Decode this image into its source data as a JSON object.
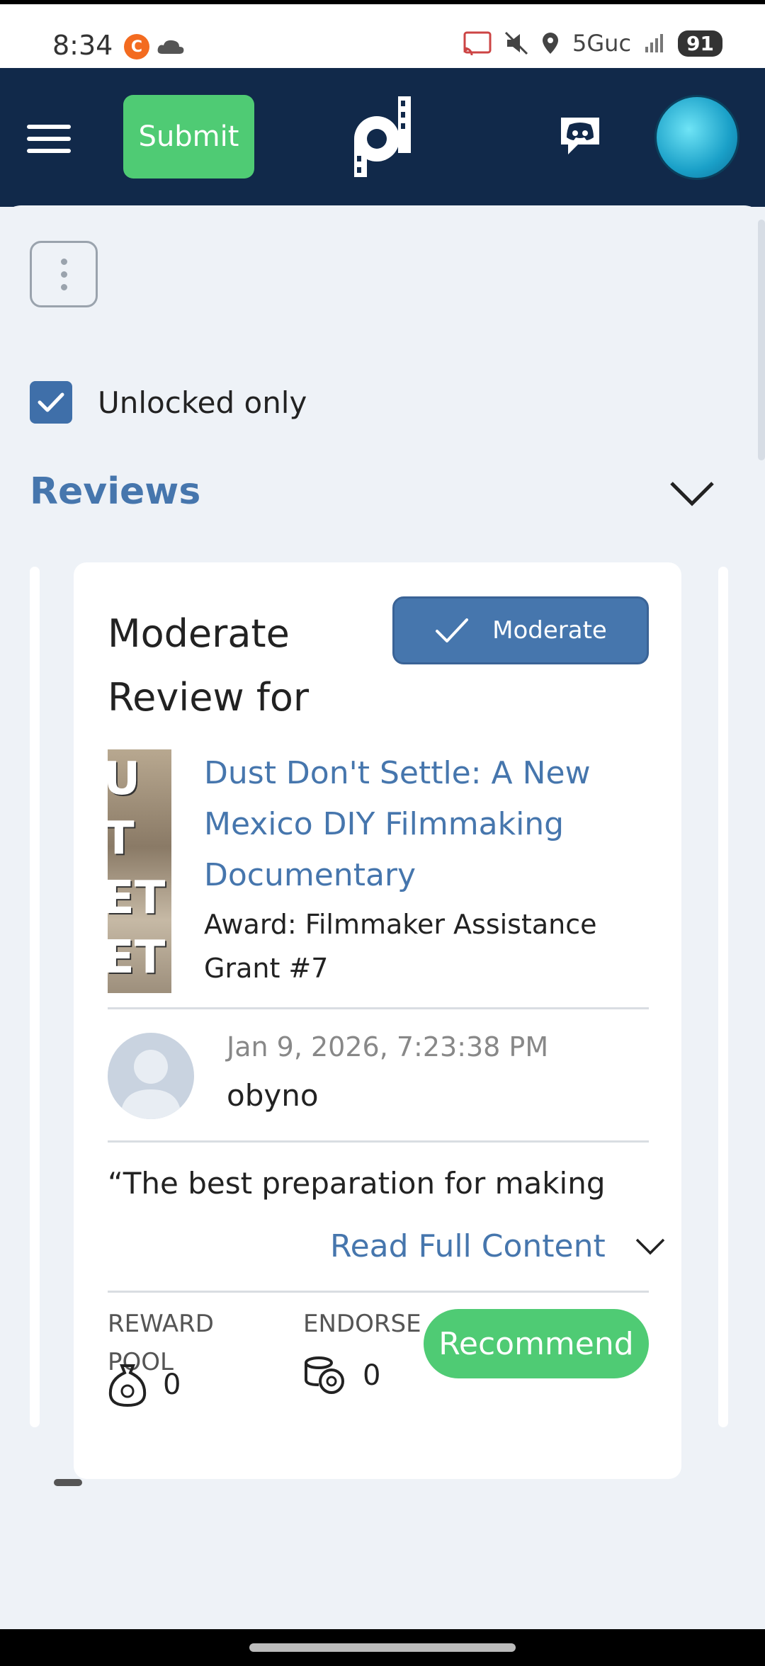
{
  "status_bar": {
    "time": "8:34",
    "network": "5Guc",
    "battery": "91",
    "app_icon": "C",
    "icons": [
      "app-notification-icon",
      "cloud-icon",
      "cast-icon",
      "mute-icon",
      "location-icon",
      "signal-icon",
      "battery-icon"
    ]
  },
  "header": {
    "submit_label": "Submit",
    "icons": [
      "menu-icon",
      "logo-icon",
      "discord-icon",
      "avatar"
    ],
    "brand_color": "#11294a",
    "accent_green": "#4fcb74"
  },
  "filters": {
    "unlocked_only_label": "Unlocked only",
    "unlocked_only_checked": true
  },
  "section": {
    "title": "Reviews",
    "accent": "#4676ad"
  },
  "card": {
    "title": "Moderate Review for",
    "moderate_label": "Moderate",
    "film_title": "Dust Don't Settle: A New Mexico DIY Filmmaking Documentary",
    "award": "Award: Filmmaker Assistance Grant #7",
    "timestamp": "Jan 9, 2026, 7:23:38 PM",
    "username": "obyno",
    "quote": "“The best preparation for making",
    "read_full_label": "Read Full Content",
    "reward_pool_label": "REWARD POOL",
    "reward_pool_value": "0",
    "endorse_label": "ENDORSE",
    "endorse_value": "0",
    "recommend_label": "Recommend"
  }
}
